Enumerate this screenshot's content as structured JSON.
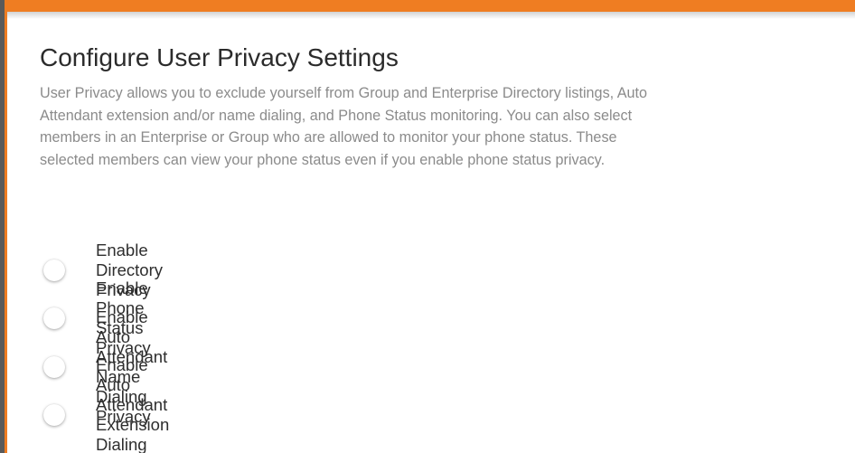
{
  "page": {
    "title": "Configure User Privacy Settings",
    "description": "User Privacy allows you to exclude yourself from Group and Enterprise Directory listings, Auto Attendant extension and/or name dialing, and Phone Status monitoring. You can also select members in an Enterprise or Group who are allowed to monitor your phone status. These selected members can view your phone status even if you enable phone status privacy."
  },
  "options": [
    {
      "label": "Enable Directory Privacy",
      "checked": false
    },
    {
      "label": "Enable Phone Status Privacy",
      "checked": false
    },
    {
      "label": "Enable Auto Attendant Name Dialing Privacy",
      "checked": false
    },
    {
      "label": "Enable Auto Attendant Extension Dialing Privacy",
      "checked": false
    }
  ],
  "colors": {
    "accent": "#ef7d22",
    "title_text": "#2b2b2b",
    "description_text": "#8b8b8b",
    "label_text": "#2e2e2e"
  }
}
